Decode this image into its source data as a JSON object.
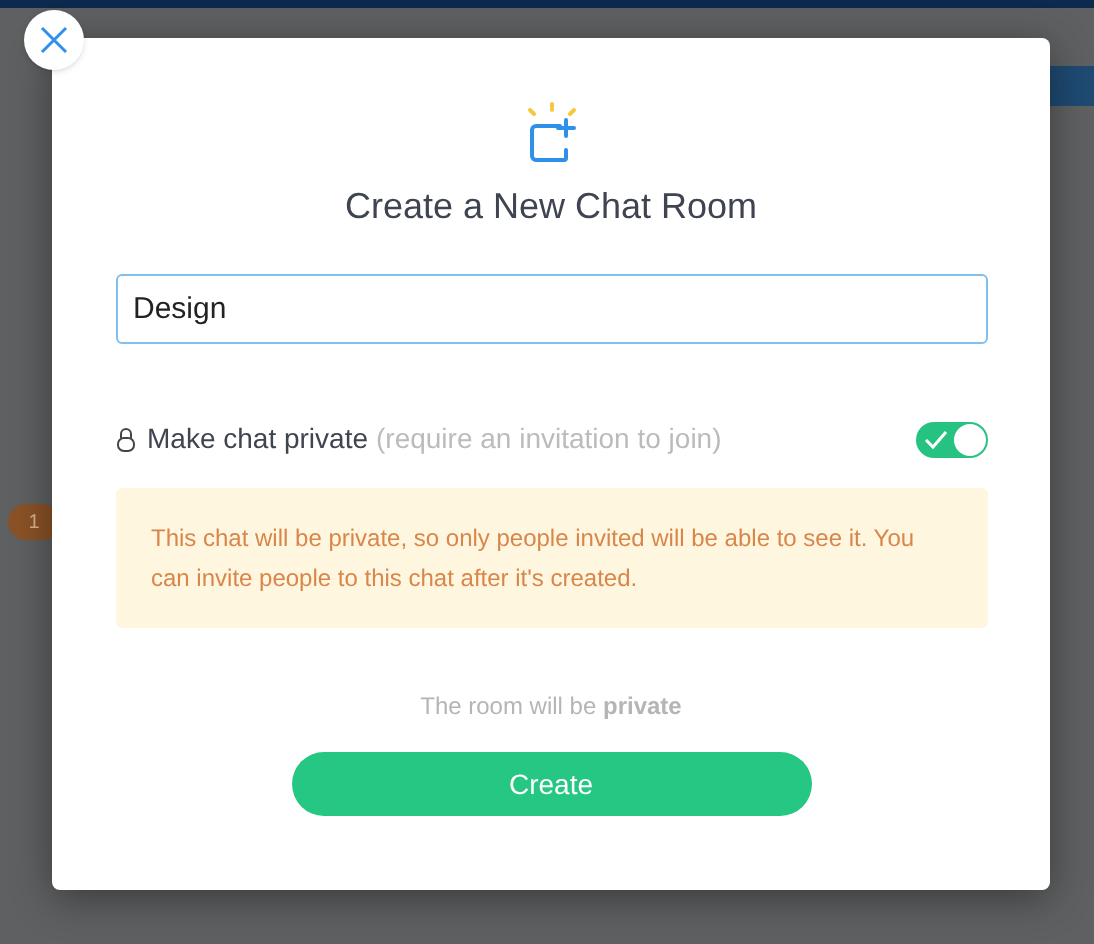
{
  "background": {
    "badge": "1"
  },
  "dialog": {
    "title": "Create a New Chat Room",
    "name_field": {
      "value": "Design"
    },
    "private_toggle": {
      "label": "Make chat private",
      "hint": "(require an invitation to join)",
      "on": true
    },
    "notice": "This chat will be private, so only people invited will be able to see it. You can invite people to this chat after it's created.",
    "status": "The room will be **private**",
    "create_button": "Create"
  }
}
